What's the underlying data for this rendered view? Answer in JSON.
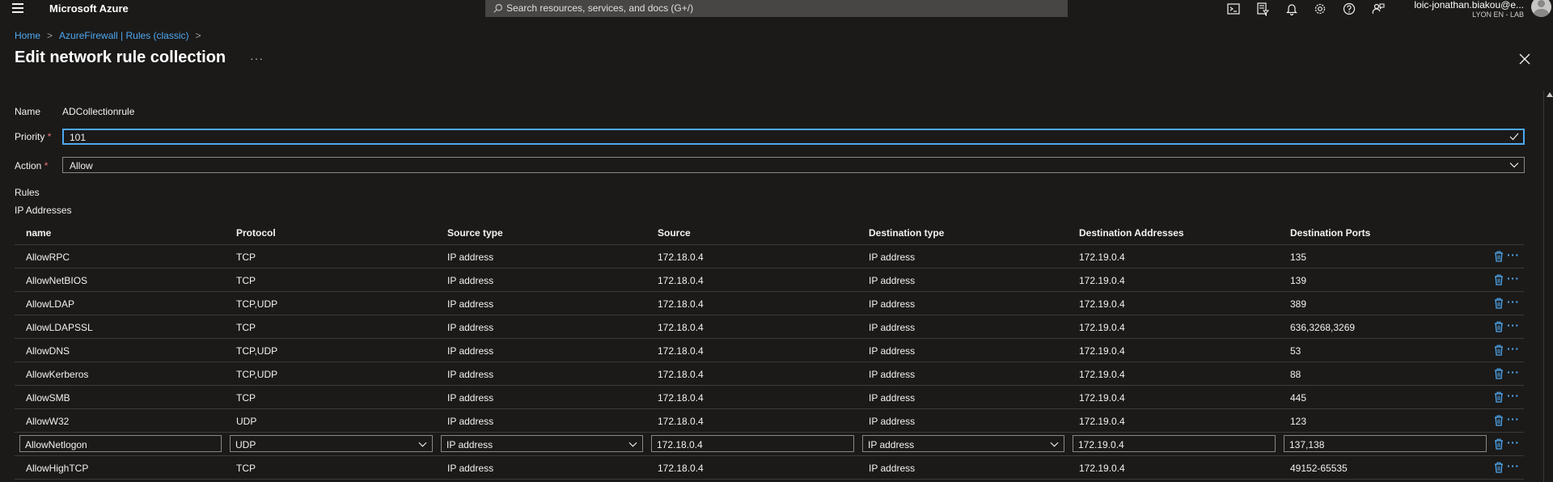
{
  "topbar": {
    "brand": "Microsoft Azure",
    "search_placeholder": "Search resources, services, and docs (G+/)",
    "icons": [
      "cloud-shell-icon",
      "directory-filter-icon",
      "notifications-icon",
      "settings-icon",
      "help-icon",
      "feedback-icon"
    ],
    "user_name": "loic-jonathan.biakou@e...",
    "user_tenant": "LYON EN - LAB"
  },
  "breadcrumb": {
    "items": [
      "Home",
      "AzureFirewall | Rules (classic)"
    ]
  },
  "page": {
    "title": "Edit network rule collection",
    "more": "···"
  },
  "form": {
    "name_label": "Name",
    "name_value": "ADCollectionrule",
    "priority_label": "Priority",
    "priority_value": "101",
    "action_label": "Action",
    "action_value": "Allow",
    "required_mark": "*",
    "rules_label": "Rules",
    "ip_addresses_label": "IP Addresses"
  },
  "table": {
    "columns": [
      "name",
      "Protocol",
      "Source type",
      "Source",
      "Destination type",
      "Destination Addresses",
      "Destination Ports"
    ],
    "rows": [
      {
        "name": "AllowRPC",
        "protocol": "TCP",
        "source_type": "IP address",
        "source": "172.18.0.4",
        "destination_type": "IP address",
        "destination_addresses": "172.19.0.4",
        "destination_ports": "135"
      },
      {
        "name": "AllowNetBIOS",
        "protocol": "TCP",
        "source_type": "IP address",
        "source": "172.18.0.4",
        "destination_type": "IP address",
        "destination_addresses": "172.19.0.4",
        "destination_ports": "139"
      },
      {
        "name": "AllowLDAP",
        "protocol": "TCP,UDP",
        "source_type": "IP address",
        "source": "172.18.0.4",
        "destination_type": "IP address",
        "destination_addresses": "172.19.0.4",
        "destination_ports": "389"
      },
      {
        "name": "AllowLDAPSSL",
        "protocol": "TCP",
        "source_type": "IP address",
        "source": "172.18.0.4",
        "destination_type": "IP address",
        "destination_addresses": "172.19.0.4",
        "destination_ports": "636,3268,3269"
      },
      {
        "name": "AllowDNS",
        "protocol": "TCP,UDP",
        "source_type": "IP address",
        "source": "172.18.0.4",
        "destination_type": "IP address",
        "destination_addresses": "172.19.0.4",
        "destination_ports": "53"
      },
      {
        "name": "AllowKerberos",
        "protocol": "TCP,UDP",
        "source_type": "IP address",
        "source": "172.18.0.4",
        "destination_type": "IP address",
        "destination_addresses": "172.19.0.4",
        "destination_ports": "88"
      },
      {
        "name": "AllowSMB",
        "protocol": "TCP",
        "source_type": "IP address",
        "source": "172.18.0.4",
        "destination_type": "IP address",
        "destination_addresses": "172.19.0.4",
        "destination_ports": "445"
      },
      {
        "name": "AllowW32",
        "protocol": "UDP",
        "source_type": "IP address",
        "source": "172.18.0.4",
        "destination_type": "IP address",
        "destination_addresses": "172.19.0.4",
        "destination_ports": "123"
      },
      {
        "name": "AllowNetlogon",
        "protocol": "UDP",
        "source_type": "IP address",
        "source": "172.18.0.4",
        "destination_type": "IP address",
        "destination_addresses": "172.19.0.4",
        "destination_ports": "137,138",
        "editing": true
      },
      {
        "name": "AllowHighTCP",
        "protocol": "TCP",
        "source_type": "IP address",
        "source": "172.18.0.4",
        "destination_type": "IP address",
        "destination_addresses": "172.19.0.4",
        "destination_ports": "49152-65535"
      }
    ],
    "row_more": "···"
  },
  "colors": {
    "background": "#1b1a19",
    "accent": "#4fa8f0",
    "required": "#f1707b",
    "border": "#8a8886"
  }
}
